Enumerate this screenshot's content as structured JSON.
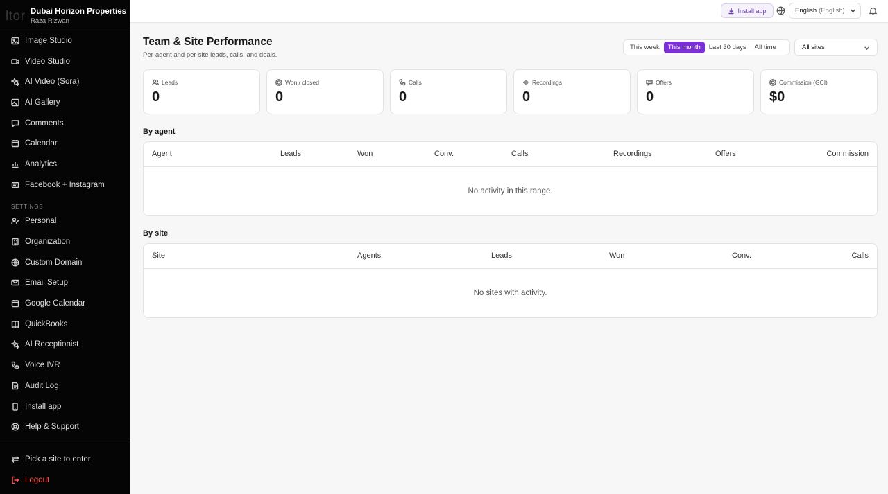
{
  "brand": {
    "logo": "ltor",
    "name": "Dubai Horizon Properties",
    "user": "Raza Rizwan"
  },
  "sidebar": {
    "items": [
      {
        "label": "Image Studio",
        "icon": "image-icon"
      },
      {
        "label": "Video Studio",
        "icon": "video-icon"
      },
      {
        "label": "AI Video (Sora)",
        "icon": "sparkles-icon"
      },
      {
        "label": "AI Gallery",
        "icon": "gallery-icon"
      },
      {
        "label": "Comments",
        "icon": "comment-icon"
      },
      {
        "label": "Calendar",
        "icon": "calendar-icon"
      },
      {
        "label": "Analytics",
        "icon": "chart-icon"
      },
      {
        "label": "Facebook + Instagram",
        "icon": "share-icon"
      }
    ],
    "settings_label": "SETTINGS",
    "settings_items": [
      {
        "label": "Personal",
        "icon": "user-icon"
      },
      {
        "label": "Organization",
        "icon": "building-icon"
      },
      {
        "label": "Custom Domain",
        "icon": "globe-icon"
      },
      {
        "label": "Email Setup",
        "icon": "mail-icon"
      },
      {
        "label": "Google Calendar",
        "icon": "calendar-icon"
      },
      {
        "label": "QuickBooks",
        "icon": "book-icon"
      },
      {
        "label": "AI Receptionist",
        "icon": "sparkles-icon"
      },
      {
        "label": "Voice IVR",
        "icon": "phone-icon"
      },
      {
        "label": "Audit Log",
        "icon": "log-icon"
      },
      {
        "label": "Install app",
        "icon": "device-icon"
      },
      {
        "label": "Help & Support",
        "icon": "help-icon"
      }
    ],
    "bottom": {
      "pick_site": "Pick a site to enter",
      "logout": "Logout"
    }
  },
  "topbar": {
    "install_label": "Install app",
    "language": "English",
    "language_sub": "(English)"
  },
  "main": {
    "title": "Team & Site Performance",
    "subtitle": "Per-agent and per-site leads, calls, and deals.",
    "ranges": [
      "This week",
      "This month",
      "Last 30 days",
      "All time"
    ],
    "active_range": "This month",
    "sites_select": "All sites",
    "cards": [
      {
        "label": "Leads",
        "value": "0",
        "icon": "users-icon"
      },
      {
        "label": "Won / closed",
        "value": "0",
        "icon": "trophy-icon"
      },
      {
        "label": "Calls",
        "value": "0",
        "icon": "phone-icon"
      },
      {
        "label": "Recordings",
        "value": "0",
        "icon": "audio-icon"
      },
      {
        "label": "Offers",
        "value": "0",
        "icon": "offer-icon"
      },
      {
        "label": "Commission (GCI)",
        "value": "$0",
        "icon": "dollar-icon"
      }
    ],
    "by_agent": {
      "title": "By agent",
      "columns": [
        "Agent",
        "Leads",
        "Won",
        "Conv.",
        "Calls",
        "Recordings",
        "Offers",
        "Commission"
      ],
      "empty": "No activity in this range."
    },
    "by_site": {
      "title": "By site",
      "columns": [
        "Site",
        "Agents",
        "Leads",
        "Won",
        "Conv.",
        "Calls"
      ],
      "empty": "No sites with activity."
    }
  },
  "colors": {
    "accent": "#7b2fd6",
    "sidebar_bg": "#050505",
    "logout": "#ff5a52"
  }
}
